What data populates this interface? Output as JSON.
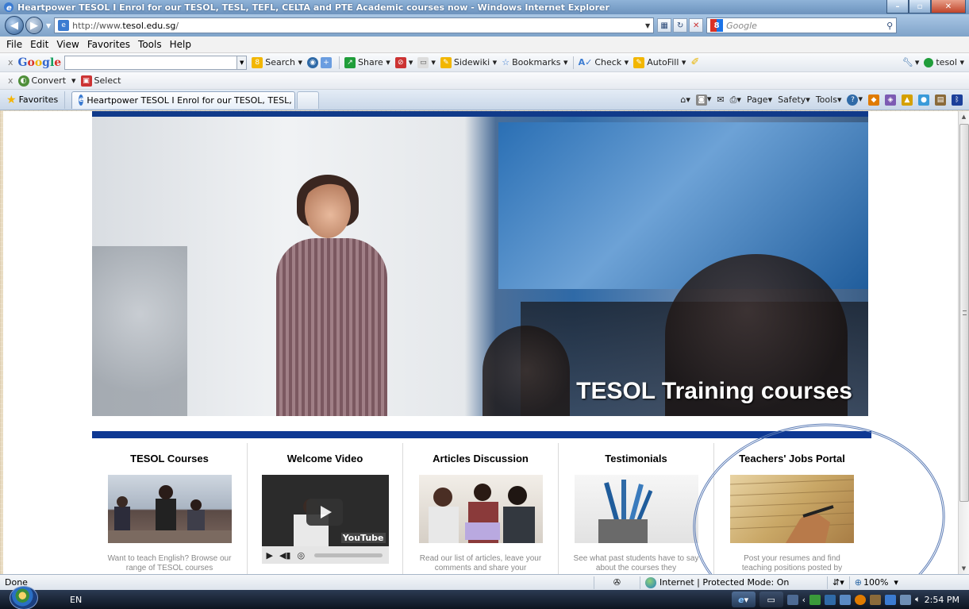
{
  "window": {
    "title": "Heartpower TESOL I Enrol for our TESOL, TESL, TEFL, CELTA and PTE Academic courses now - Windows Internet Explorer",
    "minimize_label": "–",
    "maximize_label": "▫",
    "close_label": "✕"
  },
  "address": {
    "url_prefix": "http://www.",
    "url_host": "tesol.edu.sg",
    "url_suffix": "/",
    "search_placeholder": "Google"
  },
  "menu": [
    "File",
    "Edit",
    "View",
    "Favorites",
    "Tools",
    "Help"
  ],
  "google_toolbar": {
    "close": "x",
    "logo": "Google",
    "search_label": "Search",
    "share_label": "Share",
    "sidewiki_label": "Sidewiki",
    "bookmarks_label": "Bookmarks",
    "check_label": "Check",
    "autofill_label": "AutoFill",
    "account_label": "tesol"
  },
  "convert_toolbar": {
    "close": "x",
    "convert_label": "Convert",
    "select_label": "Select"
  },
  "tabs": {
    "favorites_label": "Favorites",
    "active_tab": "Heartpower TESOL I Enrol for our TESOL, TESL, T...",
    "page_label": "Page",
    "safety_label": "Safety",
    "tools_label": "Tools"
  },
  "hero": {
    "caption": "TESOL Training courses"
  },
  "features": [
    {
      "title": "TESOL Courses",
      "text": "Want to teach English? Browse our range of TESOL courses"
    },
    {
      "title": "Welcome Video",
      "text": ""
    },
    {
      "title": "Articles Discussion",
      "text": "Read our list of articles, leave your comments and share your"
    },
    {
      "title": "Testimonials",
      "text": "See what past students have to say about the courses they"
    },
    {
      "title": "Teachers' Jobs Portal",
      "text": "Post your resumes and find teaching positions posted by"
    }
  ],
  "video": {
    "badge": "YouTube"
  },
  "status": {
    "left": "Done",
    "zone": "Internet | Protected Mode: On",
    "zoom": "100%"
  },
  "taskbar": {
    "lang": "EN",
    "clock": "2:54 PM"
  },
  "colors": {
    "brand_blue": "#0d3893",
    "annotation_circle": "#5d7db6"
  }
}
